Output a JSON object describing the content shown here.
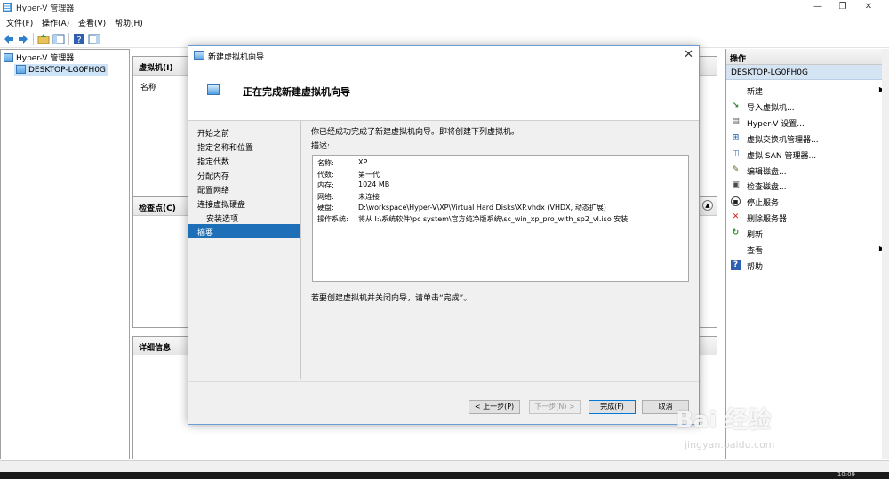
{
  "window": {
    "title": "Hyper-V 管理器",
    "min": "—",
    "max": "❐",
    "close": "✕"
  },
  "menu": [
    "文件(F)",
    "操作(A)",
    "查看(V)",
    "帮助(H)"
  ],
  "tree": {
    "root": "Hyper-V 管理器",
    "host": "DESKTOP-LG0FH0G"
  },
  "center": {
    "vm_header": "虚拟机(I)",
    "vm_col_name": "名称",
    "checkpoint_header": "检查点(C)",
    "details_header": "详细信息"
  },
  "actions": {
    "header": "操作",
    "section": "DESKTOP-LG0FH0G",
    "items": [
      {
        "label": "新建",
        "icon": "blank",
        "submenu": true
      },
      {
        "label": "导入虚拟机...",
        "icon": "import-icon"
      },
      {
        "label": "Hyper-V 设置...",
        "icon": "settings-doc-icon"
      },
      {
        "label": "虚拟交换机管理器...",
        "icon": "switch-icon"
      },
      {
        "label": "虚拟 SAN 管理器...",
        "icon": "san-icon"
      },
      {
        "label": "编辑磁盘...",
        "icon": "edit-disk-icon"
      },
      {
        "label": "检查磁盘...",
        "icon": "inspect-disk-icon"
      },
      {
        "label": "停止服务",
        "icon": "stop-icon"
      },
      {
        "label": "删除服务器",
        "icon": "delete-icon"
      },
      {
        "label": "刷新",
        "icon": "refresh-icon"
      },
      {
        "label": "查看",
        "icon": "blank",
        "submenu": true
      },
      {
        "label": "帮助",
        "icon": "help-icon"
      }
    ]
  },
  "dialog": {
    "title": "新建虚拟机向导",
    "close": "✕",
    "banner_title": "正在完成新建虚拟机向导",
    "steps": [
      "开始之前",
      "指定名称和位置",
      "指定代数",
      "分配内存",
      "配置网络",
      "连接虚拟硬盘",
      "安装选项",
      "摘要"
    ],
    "active_step": 7,
    "intro": "你已经成功完成了新建虚拟机向导。即将创建下列虚拟机。",
    "desc_label": "描述:",
    "summary": [
      {
        "k": "名称:",
        "v": "XP"
      },
      {
        "k": "代数:",
        "v": "第一代"
      },
      {
        "k": "内存:",
        "v": "1024 MB"
      },
      {
        "k": "网络:",
        "v": "未连接"
      },
      {
        "k": "硬盘:",
        "v": "D:\\workspace\\Hyper-V\\XP\\Virtual Hard Disks\\XP.vhdx (VHDX, 动态扩展)"
      },
      {
        "k": "操作系统:",
        "v": "将从 I:\\系统软件\\pc system\\官方纯净版系统\\sc_win_xp_pro_with_sp2_vl.iso 安装"
      }
    ],
    "finish_hint": "若要创建虚拟机并关闭向导，请单击“完成”。",
    "buttons": {
      "prev": "< 上一步(P)",
      "next": "下一步(N) >",
      "finish": "完成(F)",
      "cancel": "取消"
    }
  },
  "watermark": {
    "main": "Bai 经验",
    "sub": "jingyan.baidu.com"
  },
  "taskbar": {
    "clock": "10:09"
  },
  "colors": {
    "accent": "#1d6fb8",
    "selection": "#cde3f7",
    "action_section": "#d5e4f3"
  }
}
